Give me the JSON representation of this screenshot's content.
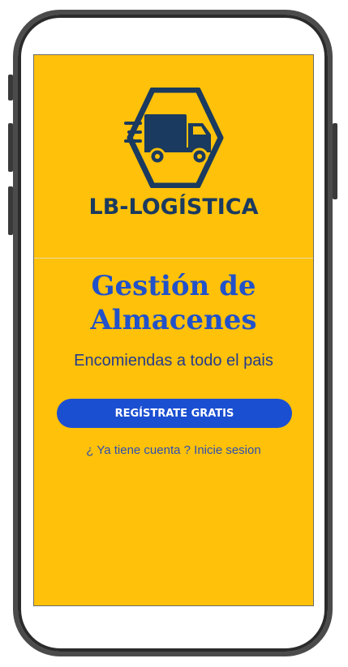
{
  "brand": {
    "name": "LB-LOGÍSTICA",
    "logo_icon": "truck-hexagon-icon",
    "color": "#1a3a5f"
  },
  "hero": {
    "title": "Gestión de Almacenes",
    "subtitle": "Encomiendas a todo el pais",
    "title_color": "#2252c9"
  },
  "actions": {
    "register_label": "REGÍSTRATE GRATIS",
    "login_label": "¿ Ya tiene cuenta ? Inicie sesion",
    "button_color": "#1b4fd1"
  },
  "theme": {
    "background": "#ffc10a"
  }
}
